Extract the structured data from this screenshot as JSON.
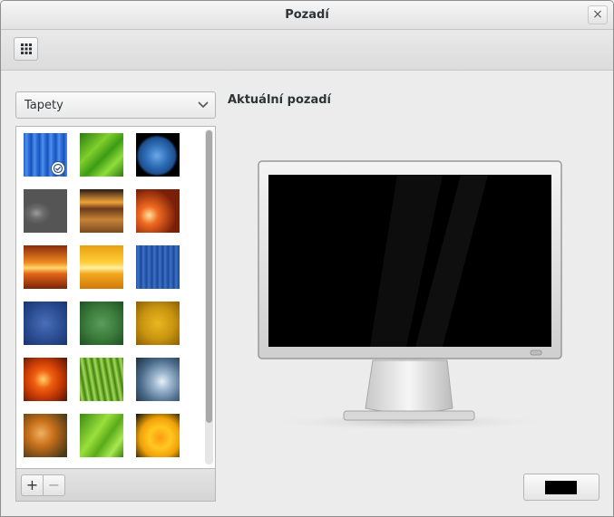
{
  "window": {
    "title": "Pozadí",
    "close_icon": "close-icon"
  },
  "toolbar": {
    "grid_icon": "grid-icon"
  },
  "source_combo": {
    "value": "Tapety",
    "icon": "chevron-down-icon"
  },
  "current_background": {
    "label": "Aktuální pozadí",
    "color": "#000000"
  },
  "gallery": {
    "thumbnails": [
      {
        "name": "blue-stripes",
        "selected": true
      },
      {
        "name": "green-leaf"
      },
      {
        "name": "earth"
      },
      {
        "name": "water-drops"
      },
      {
        "name": "sunset-dunes"
      },
      {
        "name": "orange-bokeh"
      },
      {
        "name": "orange-light"
      },
      {
        "name": "yellow-light"
      },
      {
        "name": "blue-lines"
      },
      {
        "name": "blue-gradient"
      },
      {
        "name": "green-gradient"
      },
      {
        "name": "yellow-gradient"
      },
      {
        "name": "orange-flower"
      },
      {
        "name": "grass"
      },
      {
        "name": "water-splash"
      },
      {
        "name": "dandelion"
      },
      {
        "name": "green-leaf-2"
      },
      {
        "name": "yellow-flower"
      }
    ],
    "add_label": "+",
    "remove_label": "−"
  }
}
